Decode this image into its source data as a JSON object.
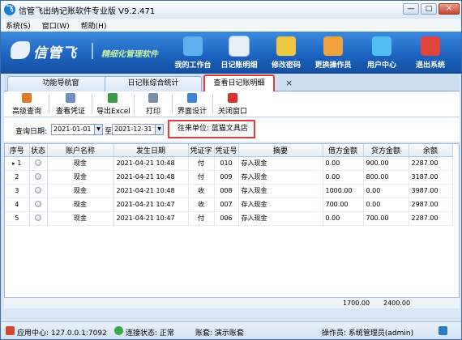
{
  "window": {
    "title": "信管飞出纳记账软件专业版 V9.2.471",
    "controls": [
      "—",
      "□",
      "✕"
    ]
  },
  "menu": [
    {
      "label": "系统(S)"
    },
    {
      "label": "窗口(W)"
    },
    {
      "label": "帮助(H)"
    }
  ],
  "banner": {
    "logo": "信管飞",
    "slogan": "精细化管理软件",
    "tools": [
      {
        "label": "我的工作台",
        "icon": "monitor-icon",
        "color": "#5fb0ef"
      },
      {
        "label": "日记账明细",
        "icon": "ledger-list-icon",
        "color": "#e8eef6"
      },
      {
        "label": "修改密码",
        "icon": "key-lock-icon",
        "color": "#f0c840"
      },
      {
        "label": "更换操作员",
        "icon": "user-switch-icon",
        "color": "#f2a23a"
      },
      {
        "label": "用户中心",
        "icon": "user-center-icon",
        "color": "#4fc0f0"
      },
      {
        "label": "退出系统",
        "icon": "power-icon",
        "color": "#e0443a"
      }
    ]
  },
  "tabs": [
    {
      "label": "功能导航窗"
    },
    {
      "label": "日记账综合统计"
    },
    {
      "label": "查看日记账明细",
      "active": true
    }
  ],
  "tab_close": "×",
  "toolbar": [
    {
      "label": "高级查询",
      "icon": "search-icon",
      "color": "#e07a2a"
    },
    {
      "label": "查看凭证",
      "icon": "voucher-icon",
      "color": "#6a8fc0"
    },
    {
      "label": "导出Excel",
      "icon": "excel-export-icon",
      "color": "#3a9a4a"
    },
    {
      "label": "打印",
      "icon": "printer-icon",
      "color": "#7b8ea8"
    },
    {
      "label": "界面设计",
      "icon": "layout-design-icon",
      "color": "#3e84d6"
    },
    {
      "label": "关闭窗口",
      "icon": "close-window-icon",
      "color": "#d8342c"
    }
  ],
  "query": {
    "date_label": "查询日期:",
    "date_from": "2021-01-01",
    "to_label": "至",
    "date_to": "2021-12-31",
    "payee_label": "往来单位:",
    "payee_value": "蓝猫文具店"
  },
  "table": {
    "columns": [
      "序号",
      "状态",
      "账户名称",
      "发生日期",
      "凭证字",
      "凭证号",
      "摘要",
      "借方金额",
      "贷方金额",
      "余额"
    ],
    "rows": [
      {
        "no": "1",
        "account": "现金",
        "date": "2021-04-21 10:48",
        "word": "付",
        "voucher": "010",
        "summary": "存入现金",
        "debit": "0.00",
        "credit": "900.00",
        "balance": "2287.00"
      },
      {
        "no": "2",
        "account": "现金",
        "date": "2021-04-21 10:48",
        "word": "付",
        "voucher": "009",
        "summary": "存入现金",
        "debit": "0.00",
        "credit": "800.00",
        "balance": "3187.00"
      },
      {
        "no": "3",
        "account": "现金",
        "date": "2021-04-21 10:48",
        "word": "收",
        "voucher": "008",
        "summary": "存入现金",
        "debit": "1000.00",
        "credit": "0.00",
        "balance": "3987.00"
      },
      {
        "no": "4",
        "account": "现金",
        "date": "2021-04-21 10:47",
        "word": "收",
        "voucher": "007",
        "summary": "存入现金",
        "debit": "700.00",
        "credit": "0.00",
        "balance": "2987.00"
      },
      {
        "no": "5",
        "account": "现金",
        "date": "2021-04-21 10:47",
        "word": "付",
        "voucher": "006",
        "summary": "存入现金",
        "debit": "0.00",
        "credit": "700.00",
        "balance": "2287.00"
      }
    ],
    "selected_marker": "▸"
  },
  "totals": {
    "debit": "1700.00",
    "credit": "2400.00"
  },
  "statusbar": {
    "app_center": "应用中心: 127.0.0.1:7092",
    "connection": "连接状态: 正常",
    "account_set": "账套: 演示账套",
    "operator": "操作员: 系统管理员(admin)"
  }
}
